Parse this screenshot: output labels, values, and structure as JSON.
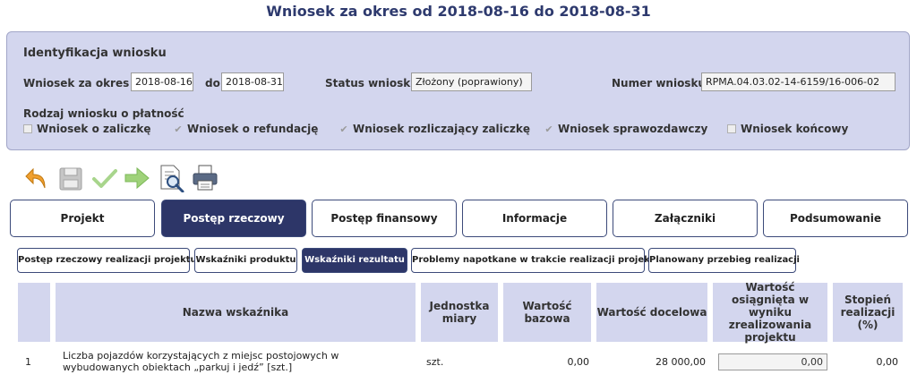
{
  "page": {
    "title": "Wniosek za okres od 2018-08-16 do 2018-08-31"
  },
  "identification": {
    "heading": "Identyfikacja wniosku",
    "period_from_label": "Wniosek za okres od",
    "period_from_value": "2018-08-16",
    "period_to_label": "do",
    "period_to_value": "2018-08-31",
    "status_label": "Status wniosku",
    "status_value": "Złożony (poprawiony)",
    "number_label": "Numer wniosku",
    "number_value": "RPMA.04.03.02-14-6159/16-006-02",
    "type_label": "Rodzaj wniosku o płatność",
    "types": [
      {
        "label": "Wniosek o zaliczkę",
        "checked": false
      },
      {
        "label": "Wniosek o refundację",
        "checked": true
      },
      {
        "label": "Wniosek rozliczający zaliczkę",
        "checked": true
      },
      {
        "label": "Wniosek sprawozdawczy",
        "checked": true
      },
      {
        "label": "Wniosek końcowy",
        "checked": false
      }
    ]
  },
  "toolbar": {
    "icons": [
      "undo-icon",
      "save-icon",
      "check-icon",
      "forward-icon",
      "preview-icon",
      "print-icon"
    ]
  },
  "main_tabs": [
    {
      "label": "Projekt",
      "active": false
    },
    {
      "label": "Postęp rzeczowy",
      "active": true
    },
    {
      "label": "Postęp finansowy",
      "active": false
    },
    {
      "label": "Informacje",
      "active": false
    },
    {
      "label": "Załączniki",
      "active": false
    },
    {
      "label": "Podsumowanie",
      "active": false
    }
  ],
  "sub_tabs": [
    {
      "label": "Postęp rzeczowy realizacji projektu",
      "active": false
    },
    {
      "label": "Wskaźniki produktu",
      "active": false
    },
    {
      "label": "Wskaźniki rezultatu",
      "active": true
    },
    {
      "label": "Problemy napotkane w trakcie realizacji projektu",
      "active": false
    },
    {
      "label": "Planowany przebieg realizacji",
      "active": false
    }
  ],
  "table": {
    "headers": {
      "lp": "",
      "name": "Nazwa wskaźnika",
      "unit": "Jednostka miary",
      "base": "Wartość bazowa",
      "target": "Wartość docelowa",
      "achieved": "Wartość osiągnięta w wyniku zrealizowania projektu",
      "degree": "Stopień realizacji (%)"
    },
    "rows": [
      {
        "lp": "1",
        "name": "Liczba pojazdów korzystających z miejsc postojowych w wybudowanych obiektach „parkuj i jedź” [szt.]",
        "unit": "szt.",
        "base": "0,00",
        "target": "28 000,00",
        "achieved": "0,00",
        "degree": "0,00"
      }
    ]
  }
}
